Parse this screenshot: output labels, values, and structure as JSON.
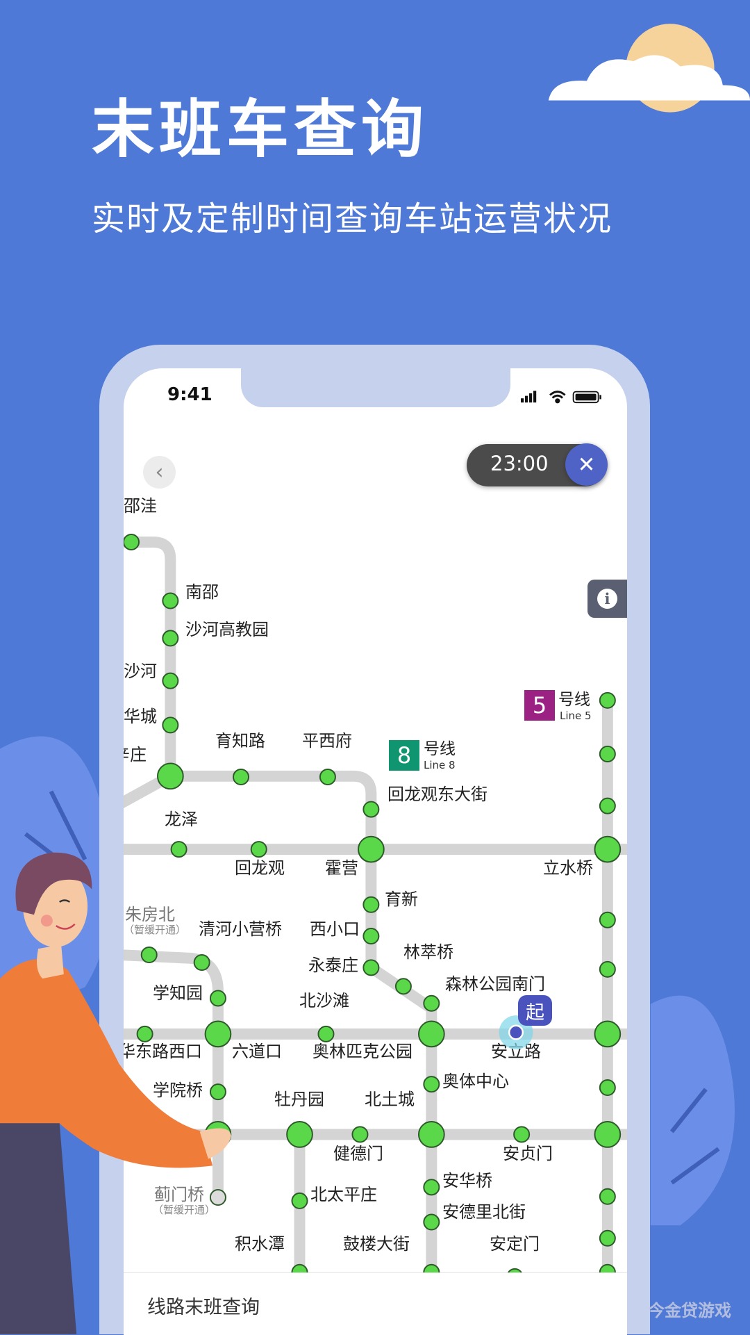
{
  "hero": {
    "title": "末班车查询",
    "subtitle": "实时及定制时间查询车站运营状况"
  },
  "status_bar": {
    "time": "9:41",
    "icons": [
      "signal-icon",
      "wifi-icon",
      "battery-icon"
    ]
  },
  "toolbar": {
    "back_icon": "chevron-left-icon",
    "time_filter": "23:00",
    "close_icon": "close-icon",
    "info_icon": "info-icon"
  },
  "colors": {
    "background": "#4e79d6",
    "station": "#5ad84a",
    "track": "#d4d4d4",
    "line5": "#9b2283",
    "line8": "#0f9570",
    "start_marker": "#4a52bd"
  },
  "lines": [
    {
      "number": "5",
      "name": "号线",
      "en": "Line 5"
    },
    {
      "number": "8",
      "name": "号线",
      "en": "Line 8"
    }
  ],
  "map": {
    "stations": [
      "邵洼",
      "南邵",
      "沙河高教园",
      "沙河",
      "华城",
      "辛庄",
      "育知路",
      "平西府",
      "回龙观东大街",
      "龙泽",
      "回龙观",
      "霍营",
      "立水桥",
      "朱房北",
      "清河小营桥",
      "西小口",
      "育新",
      "林萃桥",
      "永泰庄",
      "森林公园南门",
      "学知园",
      "北沙滩",
      "华东路西口",
      "六道口",
      "奥林匹克公园",
      "安立路",
      "奥体中心",
      "学院桥",
      "牡丹园",
      "北土城",
      "健德门",
      "安贞门",
      "安华桥",
      "蓟门桥",
      "北太平庄",
      "安德里北街",
      "积水潭",
      "鼓楼大街",
      "安定门"
    ],
    "suspended_note": "（暂缓开通）",
    "start_marker": "起"
  },
  "bottom_panel": {
    "title": "线路末班查询"
  },
  "watermark": "今金贷游戏"
}
